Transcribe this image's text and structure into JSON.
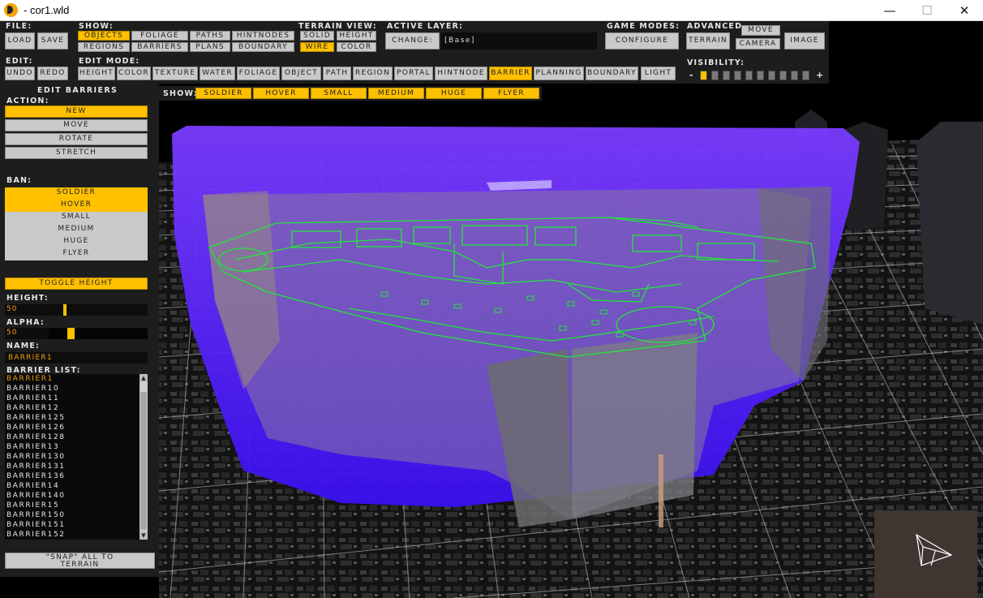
{
  "window": {
    "title": "- cor1.wld"
  },
  "toolbar": {
    "file": {
      "label": "File:",
      "load": "Load",
      "save": "Save"
    },
    "show": {
      "label": "Show:",
      "objects": "Objects",
      "foliage": "Foliage",
      "paths": "Paths",
      "hintnodes": "HintNodes",
      "regions": "Regions",
      "barriers": "Barriers",
      "plans": "Plans",
      "boundary": "Boundary"
    },
    "terrain_view": {
      "label": "Terrain View:",
      "solid": "Solid",
      "height": "Height",
      "wire": "Wire",
      "color": "Color"
    },
    "active_layer": {
      "label": "Active Layer:",
      "change": "Change:",
      "value": "[Base]"
    },
    "game_modes": {
      "label": "Game Modes:",
      "configure": "Configure"
    },
    "advanced": {
      "label": "Advanced",
      "move": "Move",
      "terrain": "Terrain",
      "camera": "Camera",
      "image": "Image"
    },
    "edit": {
      "label": "Edit:",
      "undo": "Undo",
      "redo": "Redo"
    },
    "edit_mode": {
      "label": "Edit Mode:",
      "items": [
        "Height",
        "Color",
        "Texture",
        "Water",
        "Foliage",
        "Object",
        "Path",
        "Region",
        "Portal",
        "HintNode",
        "Barrier",
        "Planning",
        "Boundary",
        "Light"
      ],
      "active": "Barrier"
    },
    "visibility": {
      "label": "Visibility:",
      "minus": "-",
      "plus": "+",
      "level": 1,
      "steps": 10
    }
  },
  "show_bar": {
    "label": "Show:",
    "items": [
      "Soldier",
      "Hover",
      "Small",
      "Medium",
      "Huge",
      "Flyer"
    ]
  },
  "left_panel": {
    "heading": "Edit Barriers",
    "action_label": "Action:",
    "actions": [
      "New",
      "Move",
      "Rotate",
      "Stretch"
    ],
    "active_action": "New",
    "ban_label": "Ban:",
    "ban": [
      "Soldier",
      "Hover",
      "Small",
      "Medium",
      "Huge",
      "Flyer"
    ],
    "ban_active": [
      "Soldier",
      "Hover"
    ],
    "toggle_height": "Toggle Height",
    "height_label": "Height:",
    "height_value": "50",
    "alpha_label": "Alpha:",
    "alpha_value": "50",
    "name_label": "Name:",
    "name_value": "Barrier1",
    "list_label": "Barrier List:",
    "list": [
      "Barrier1",
      "Barrier10",
      "Barrier11",
      "Barrier12",
      "Barrier125",
      "Barrier126",
      "Barrier128",
      "Barrier13",
      "Barrier130",
      "Barrier131",
      "Barrier136",
      "Barrier14",
      "Barrier140",
      "Barrier15",
      "Barrier150",
      "Barrier151",
      "Barrier152"
    ],
    "selected": "Barrier1",
    "snap_line1": "\"Snap\" All To",
    "snap_line2": "Terrain"
  },
  "colors": {
    "accent": "#ffc000",
    "barrier": "#5a1aff",
    "pathgrid": "#22e63a",
    "panel": "#1d1d1d"
  }
}
